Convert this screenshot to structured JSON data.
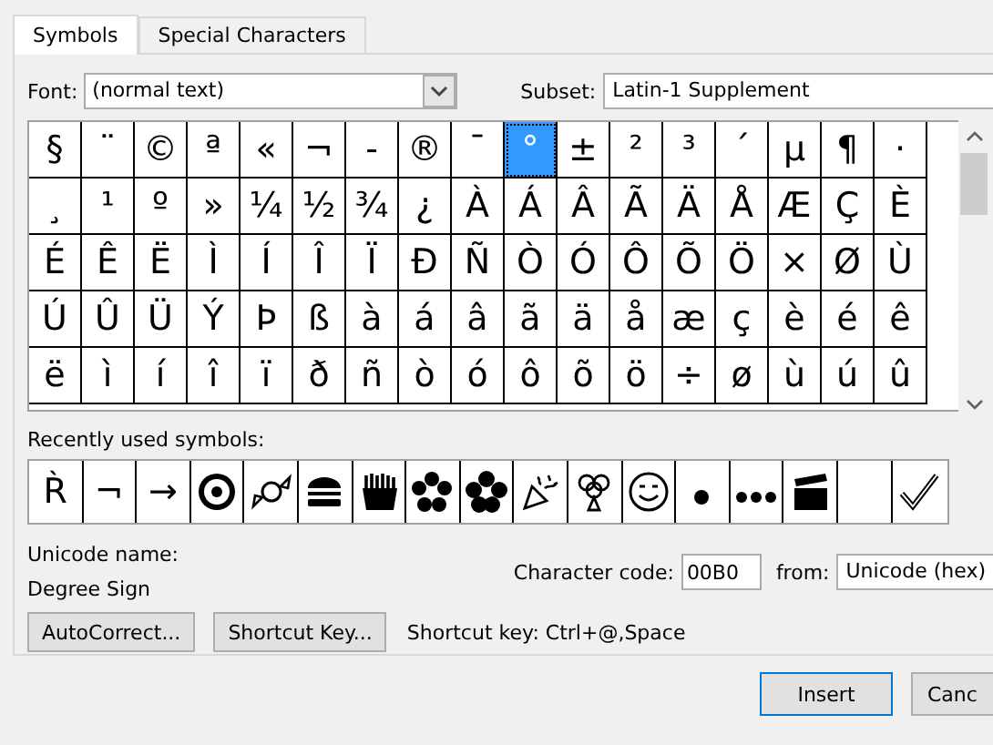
{
  "tabs": [
    {
      "label": "Symbols",
      "selected": true
    },
    {
      "label": "Special Characters",
      "selected": false
    }
  ],
  "font": {
    "label": "Font:",
    "value": "(normal text)"
  },
  "subset": {
    "label": "Subset:",
    "value": "Latin-1 Supplement"
  },
  "symbols": [
    {
      "char": "§",
      "selected": false
    },
    {
      "char": "¨",
      "selected": false
    },
    {
      "char": "©",
      "selected": false
    },
    {
      "char": "ª",
      "selected": false
    },
    {
      "char": "«",
      "selected": false
    },
    {
      "char": "¬",
      "selected": false
    },
    {
      "char": "-",
      "selected": false
    },
    {
      "char": "®",
      "selected": false
    },
    {
      "char": "¯",
      "selected": false
    },
    {
      "char": "°",
      "selected": true
    },
    {
      "char": "±",
      "selected": false
    },
    {
      "char": "²",
      "selected": false
    },
    {
      "char": "³",
      "selected": false
    },
    {
      "char": "´",
      "selected": false
    },
    {
      "char": "µ",
      "selected": false
    },
    {
      "char": "¶",
      "selected": false
    },
    {
      "char": "·",
      "selected": false
    },
    {
      "char": "¸",
      "selected": false
    },
    {
      "char": "¹",
      "selected": false
    },
    {
      "char": "º",
      "selected": false
    },
    {
      "char": "»",
      "selected": false
    },
    {
      "char": "¼",
      "selected": false
    },
    {
      "char": "½",
      "selected": false
    },
    {
      "char": "¾",
      "selected": false
    },
    {
      "char": "¿",
      "selected": false
    },
    {
      "char": "À",
      "selected": false
    },
    {
      "char": "Á",
      "selected": false
    },
    {
      "char": "Â",
      "selected": false
    },
    {
      "char": "Ã",
      "selected": false
    },
    {
      "char": "Ä",
      "selected": false
    },
    {
      "char": "Å",
      "selected": false
    },
    {
      "char": "Æ",
      "selected": false
    },
    {
      "char": "Ç",
      "selected": false
    },
    {
      "char": "È",
      "selected": false
    },
    {
      "char": "É",
      "selected": false
    },
    {
      "char": "Ê",
      "selected": false
    },
    {
      "char": "Ë",
      "selected": false
    },
    {
      "char": "Ì",
      "selected": false
    },
    {
      "char": "Í",
      "selected": false
    },
    {
      "char": "Î",
      "selected": false
    },
    {
      "char": "Ï",
      "selected": false
    },
    {
      "char": "Ð",
      "selected": false
    },
    {
      "char": "Ñ",
      "selected": false
    },
    {
      "char": "Ò",
      "selected": false
    },
    {
      "char": "Ó",
      "selected": false
    },
    {
      "char": "Ô",
      "selected": false
    },
    {
      "char": "Õ",
      "selected": false
    },
    {
      "char": "Ö",
      "selected": false
    },
    {
      "char": "×",
      "selected": false
    },
    {
      "char": "Ø",
      "selected": false
    },
    {
      "char": "Ù",
      "selected": false
    },
    {
      "char": "Ú",
      "selected": false
    },
    {
      "char": "Û",
      "selected": false
    },
    {
      "char": "Ü",
      "selected": false
    },
    {
      "char": "Ý",
      "selected": false
    },
    {
      "char": "Þ",
      "selected": false
    },
    {
      "char": "ß",
      "selected": false
    },
    {
      "char": "à",
      "selected": false
    },
    {
      "char": "á",
      "selected": false
    },
    {
      "char": "â",
      "selected": false
    },
    {
      "char": "ã",
      "selected": false
    },
    {
      "char": "ä",
      "selected": false
    },
    {
      "char": "å",
      "selected": false
    },
    {
      "char": "æ",
      "selected": false
    },
    {
      "char": "ç",
      "selected": false
    },
    {
      "char": "è",
      "selected": false
    },
    {
      "char": "é",
      "selected": false
    },
    {
      "char": "ê",
      "selected": false
    },
    {
      "char": "ë",
      "selected": false
    },
    {
      "char": "ì",
      "selected": false
    },
    {
      "char": "í",
      "selected": false
    },
    {
      "char": "î",
      "selected": false
    },
    {
      "char": "ï",
      "selected": false
    },
    {
      "char": "ð",
      "selected": false
    },
    {
      "char": "ñ",
      "selected": false
    },
    {
      "char": "ò",
      "selected": false
    },
    {
      "char": "ó",
      "selected": false
    },
    {
      "char": "ô",
      "selected": false
    },
    {
      "char": "õ",
      "selected": false
    },
    {
      "char": "ö",
      "selected": false
    },
    {
      "char": "÷",
      "selected": false
    },
    {
      "char": "ø",
      "selected": false
    },
    {
      "char": "ù",
      "selected": false
    },
    {
      "char": "ú",
      "selected": false
    },
    {
      "char": "û",
      "selected": false
    }
  ],
  "recent": {
    "label": "Recently used symbols:",
    "items": [
      {
        "kind": "glyph",
        "char": "R̀"
      },
      {
        "kind": "glyph",
        "char": "¬"
      },
      {
        "kind": "glyph",
        "char": "→"
      },
      {
        "kind": "picture"
      },
      {
        "kind": "picture"
      },
      {
        "kind": "picture"
      },
      {
        "kind": "picture"
      },
      {
        "kind": "picture"
      },
      {
        "kind": "picture"
      },
      {
        "kind": "picture"
      },
      {
        "kind": "picture"
      },
      {
        "kind": "picture"
      },
      {
        "kind": "picture"
      },
      {
        "kind": "picture"
      },
      {
        "kind": "picture"
      },
      {
        "kind": "empty"
      },
      {
        "kind": "picture"
      }
    ]
  },
  "unicode_name": {
    "label": "Unicode name:",
    "value": "Degree Sign"
  },
  "character_code": {
    "label": "Character code:",
    "value": "00B0"
  },
  "from": {
    "label": "from:",
    "value": "Unicode (hex)"
  },
  "autocorrect_button": "AutoCorrect...",
  "shortcut_key_button": "Shortcut Key...",
  "shortcut_key": "Shortcut key: Ctrl+@,Space",
  "buttons": [
    {
      "label": "Insert",
      "default": true
    },
    {
      "label": "Canc",
      "default": false
    }
  ]
}
